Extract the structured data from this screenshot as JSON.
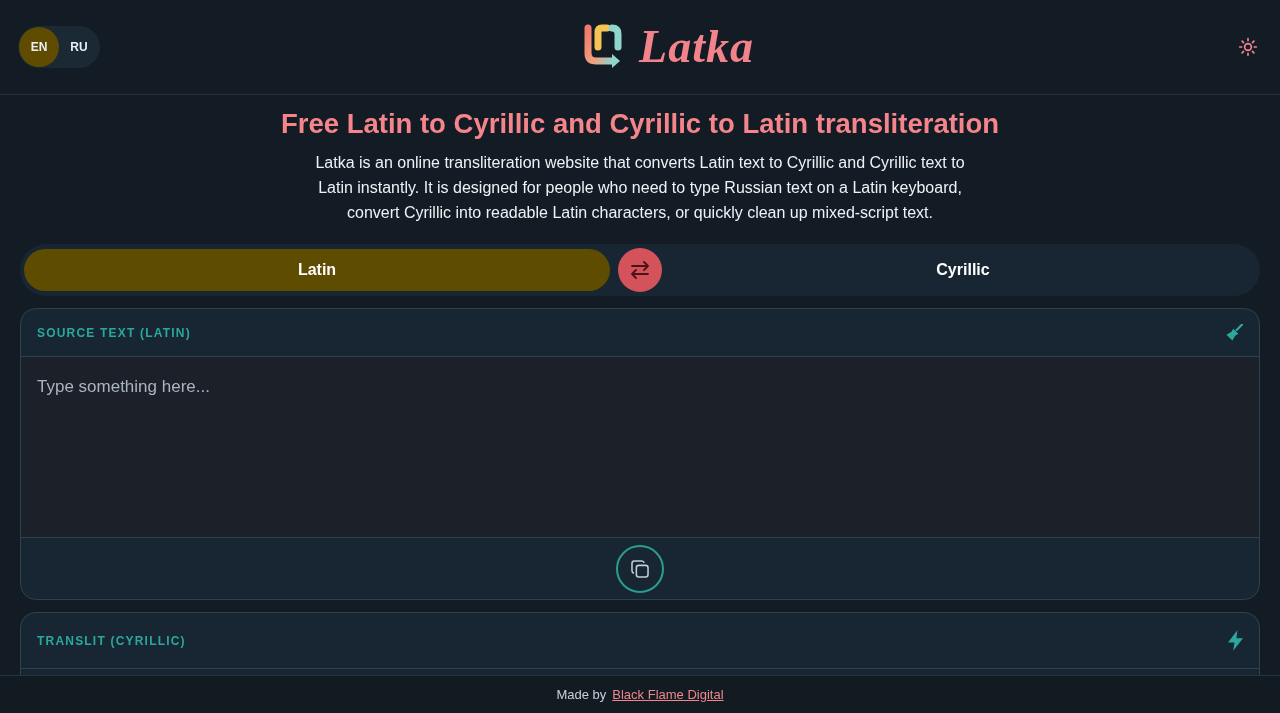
{
  "header": {
    "languages": [
      {
        "label": "EN",
        "selected": true
      },
      {
        "label": "RU",
        "selected": false
      }
    ],
    "logo_text": "Latka"
  },
  "intro": {
    "title": "Free Latin to Cyrillic and Cyrillic to Latin transliteration",
    "description": "Latka is an online transliteration website that converts Latin text to Cyrillic and Cyrillic text to Latin instantly. It is designed for people who need to type Russian text on a Latin keyboard, convert Cyrillic into readable Latin characters, or quickly clean up mixed-script text."
  },
  "direction": {
    "options": [
      {
        "label": "Latin",
        "selected": true
      },
      {
        "label": "Cyrillic",
        "selected": false
      }
    ]
  },
  "panels": [
    {
      "kind": "source",
      "label": "SOURCE TEXT (LATIN)",
      "placeholder": "Type something here..."
    },
    {
      "kind": "output",
      "label": "TRANSLIT (CYRILLIC)"
    }
  ],
  "footer": {
    "prefix": "Made by",
    "link": "Black Flame Digital"
  }
}
